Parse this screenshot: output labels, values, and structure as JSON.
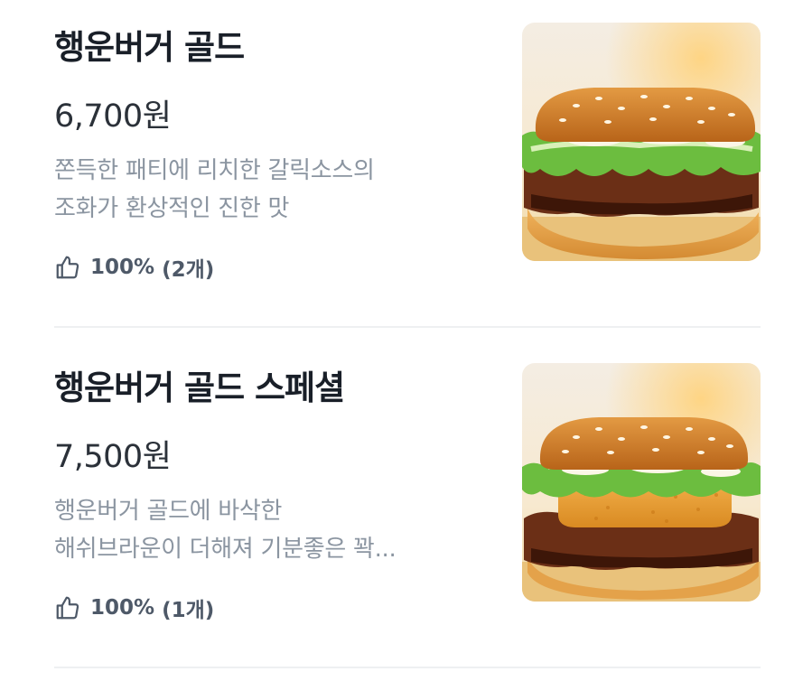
{
  "menu": {
    "items": [
      {
        "name": "행운버거 골드",
        "price": "6,700원",
        "desc_lines": [
          "쫀득한 패티에 리치한 갈릭소스의",
          "조화가 환상적인 진한 맛"
        ],
        "rating_percent": "100%",
        "rating_count": "(2개)",
        "image_icon": "burger-image"
      },
      {
        "name": "행운버거 골드 스페셜",
        "price": "7,500원",
        "desc_lines": [
          "행운버거 골드에 바삭한",
          "해쉬브라운이 더해져 기분좋은 꽉..."
        ],
        "rating_percent": "100%",
        "rating_count": "(1개)",
        "image_icon": "burger-hashbrown-image"
      }
    ]
  },
  "colors": {
    "title": "#191f28",
    "price": "#2b3139",
    "description": "#8b95a1",
    "rating": "#4e5968",
    "divider": "#eef0f2"
  }
}
